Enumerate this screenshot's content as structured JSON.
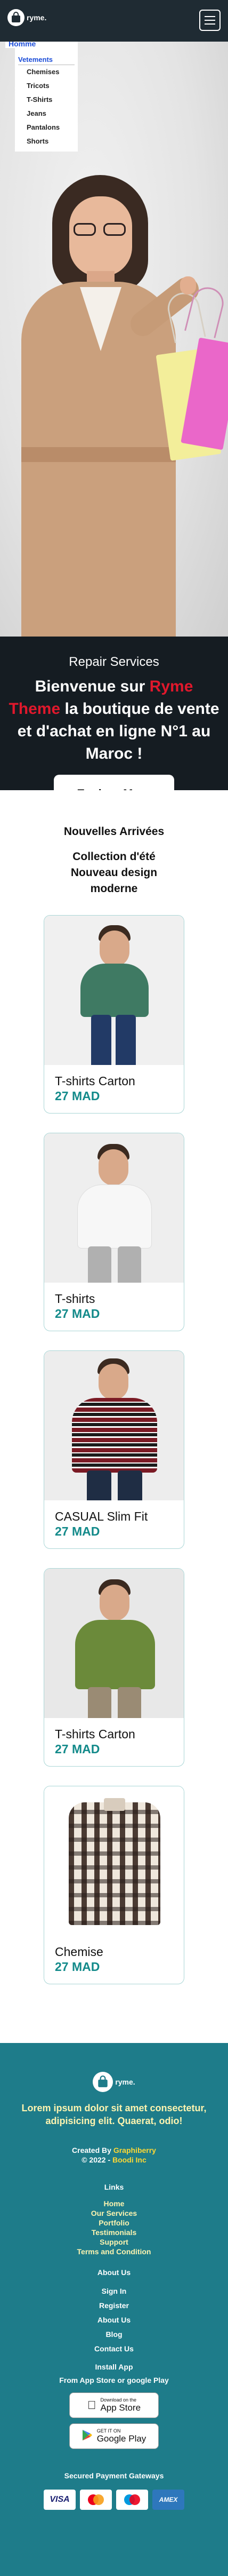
{
  "header": {
    "logo_text": "ryme.",
    "menu_icon": "hamburger-menu-icon"
  },
  "nav": {
    "home": "Homme",
    "category": "Vetements",
    "subitems": [
      "Chemises",
      "Tricots",
      "T-Shirts",
      "Jeans",
      "Pantalons",
      "Shorts"
    ]
  },
  "hero": {
    "eyebrow": "Repair Services",
    "title_before": "Bienvenue sur ",
    "title_highlight": "Ryme Theme",
    "title_after": " la boutique de vente et d'achat en ligne N°1 au Maroc !",
    "cta": "Explore More",
    "highlight_color": "#e0182c"
  },
  "products": {
    "title": "Nouvelles Arrivées",
    "subtitle": "Collection d'été Nouveau design moderne",
    "items": [
      {
        "name": "T-shirts Carton",
        "price": "27 MAD"
      },
      {
        "name": "T-shirts",
        "price": "27 MAD"
      },
      {
        "name": "CASUAL Slim Fit",
        "price": "27 MAD"
      },
      {
        "name": "T-shirts Carton",
        "price": "27 MAD"
      },
      {
        "name": "Chemise",
        "price": "27 MAD"
      }
    ],
    "price_color": "#138a8a"
  },
  "footer": {
    "logo_text": "ryme.",
    "lorem": "Lorem ipsum dolor sit amet consectetur, adipisicing elit. Quaerat, odio!",
    "created_prefix": "Created By ",
    "created_by": "Graphiberry",
    "copyright_prefix": "© 2022 - ",
    "copyright_org": "Boodi Inc",
    "links_title": "Links",
    "links": [
      "Home",
      "Our Services",
      "Portfolio",
      "Testimonials",
      "Support",
      "Terms and Condition"
    ],
    "about_title": "About Us",
    "about_links": [
      "Sign In",
      "Register",
      "About Us",
      "Blog",
      "Contact Us"
    ],
    "install_title": "Install App",
    "install_sub": "From App Store or google Play",
    "appstore_small": "Download on the",
    "appstore_big": "App Store",
    "gplay_small": "GET IT ON",
    "gplay_big": "Google Play",
    "payments_title": "Secured Payment Gateways",
    "payments": [
      "VISA",
      "MC",
      "Maestro",
      "AMEX"
    ],
    "bg_color": "#1e7c8a"
  }
}
